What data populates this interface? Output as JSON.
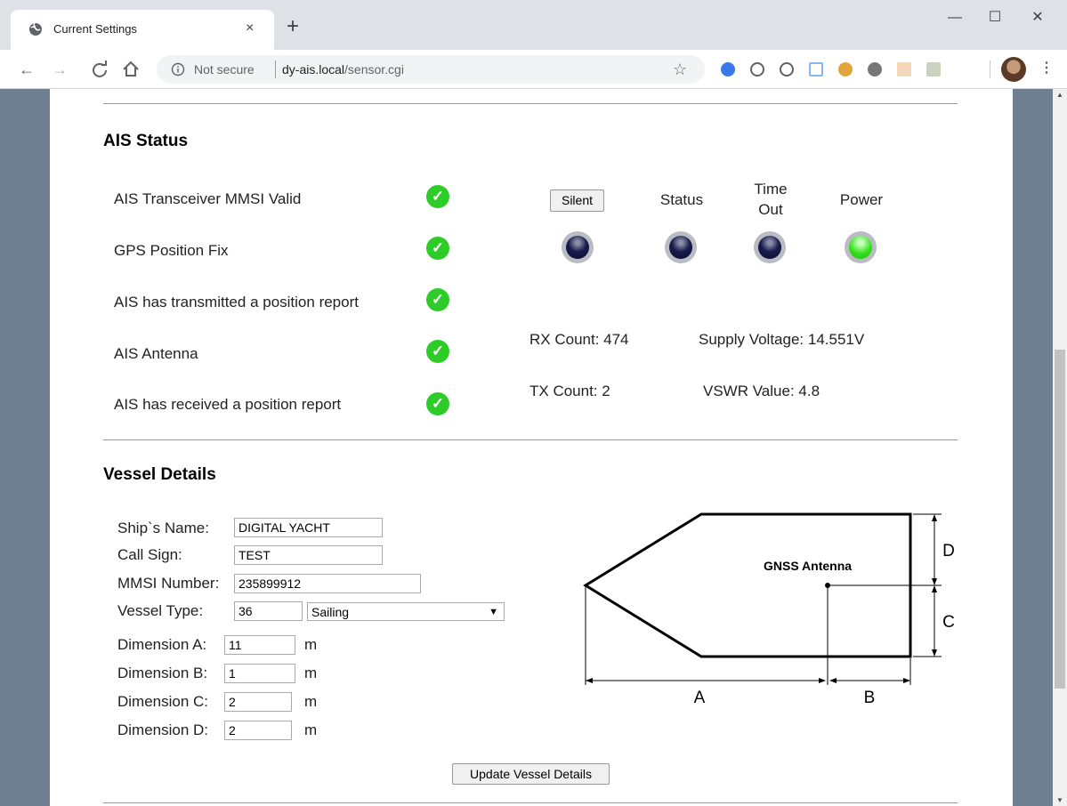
{
  "browser": {
    "tab_title": "Current Settings",
    "tab_close": "×",
    "new_tab": "+",
    "window_min": "—",
    "window_max": "☐",
    "window_close": "✕",
    "security_label": "Not secure",
    "url_host": "dy-ais.local",
    "url_path": "/sensor.cgi",
    "extension_icons": [
      "webstore-icon",
      "ip-icon",
      "code-icon",
      "spellcheck-icon",
      "owl-icon",
      "circle-icon",
      "notes-icon",
      "cast-icon"
    ]
  },
  "ais_status": {
    "title": "AIS Status",
    "checks": [
      {
        "label": "AIS Transceiver MMSI Valid",
        "ok": true
      },
      {
        "label": "GPS Position Fix",
        "ok": true
      },
      {
        "label": "AIS has transmitted a position report",
        "ok": true
      },
      {
        "label": "AIS Antenna",
        "ok": true
      },
      {
        "label": "AIS has received a position report",
        "ok": true
      }
    ],
    "check_glyph": "✓",
    "silent_button": "Silent",
    "status_label": "Status",
    "timeout_label_line1": "Time",
    "timeout_label_line2": "Out",
    "power_label": "Power",
    "leds": {
      "silent": false,
      "status": false,
      "timeout": false,
      "power": true
    },
    "rx_count": "RX Count: 474",
    "tx_count": "TX Count: 2",
    "supply_voltage": "Supply Voltage: 14.551V",
    "vswr_value": "VSWR Value: 4.8"
  },
  "vessel": {
    "title": "Vessel Details",
    "ship_name_label": "Ship`s Name:",
    "ship_name": "DIGITAL YACHT",
    "call_sign_label": "Call Sign:",
    "call_sign": "TEST",
    "mmsi_label": "MMSI Number:",
    "mmsi": "235899912",
    "vessel_type_label": "Vessel Type:",
    "vessel_type_code": "36",
    "vessel_type": "Sailing",
    "dim_a_label": "Dimension A:",
    "dim_a": "11",
    "dim_b_label": "Dimension B:",
    "dim_b": "1",
    "dim_c_label": "Dimension C:",
    "dim_c": "2",
    "dim_d_label": "Dimension D:",
    "dim_d": "2",
    "unit": "m",
    "update_button": "Update Vessel Details"
  },
  "diagram": {
    "antenna_label": "GNSS Antenna",
    "label_a": "A",
    "label_b": "B",
    "label_c": "C",
    "label_d": "D"
  },
  "colors": {
    "page_bg": "#708090",
    "check_green": "#2ecc28",
    "led_off": "#0a0b36",
    "led_on": "#34e01c"
  }
}
